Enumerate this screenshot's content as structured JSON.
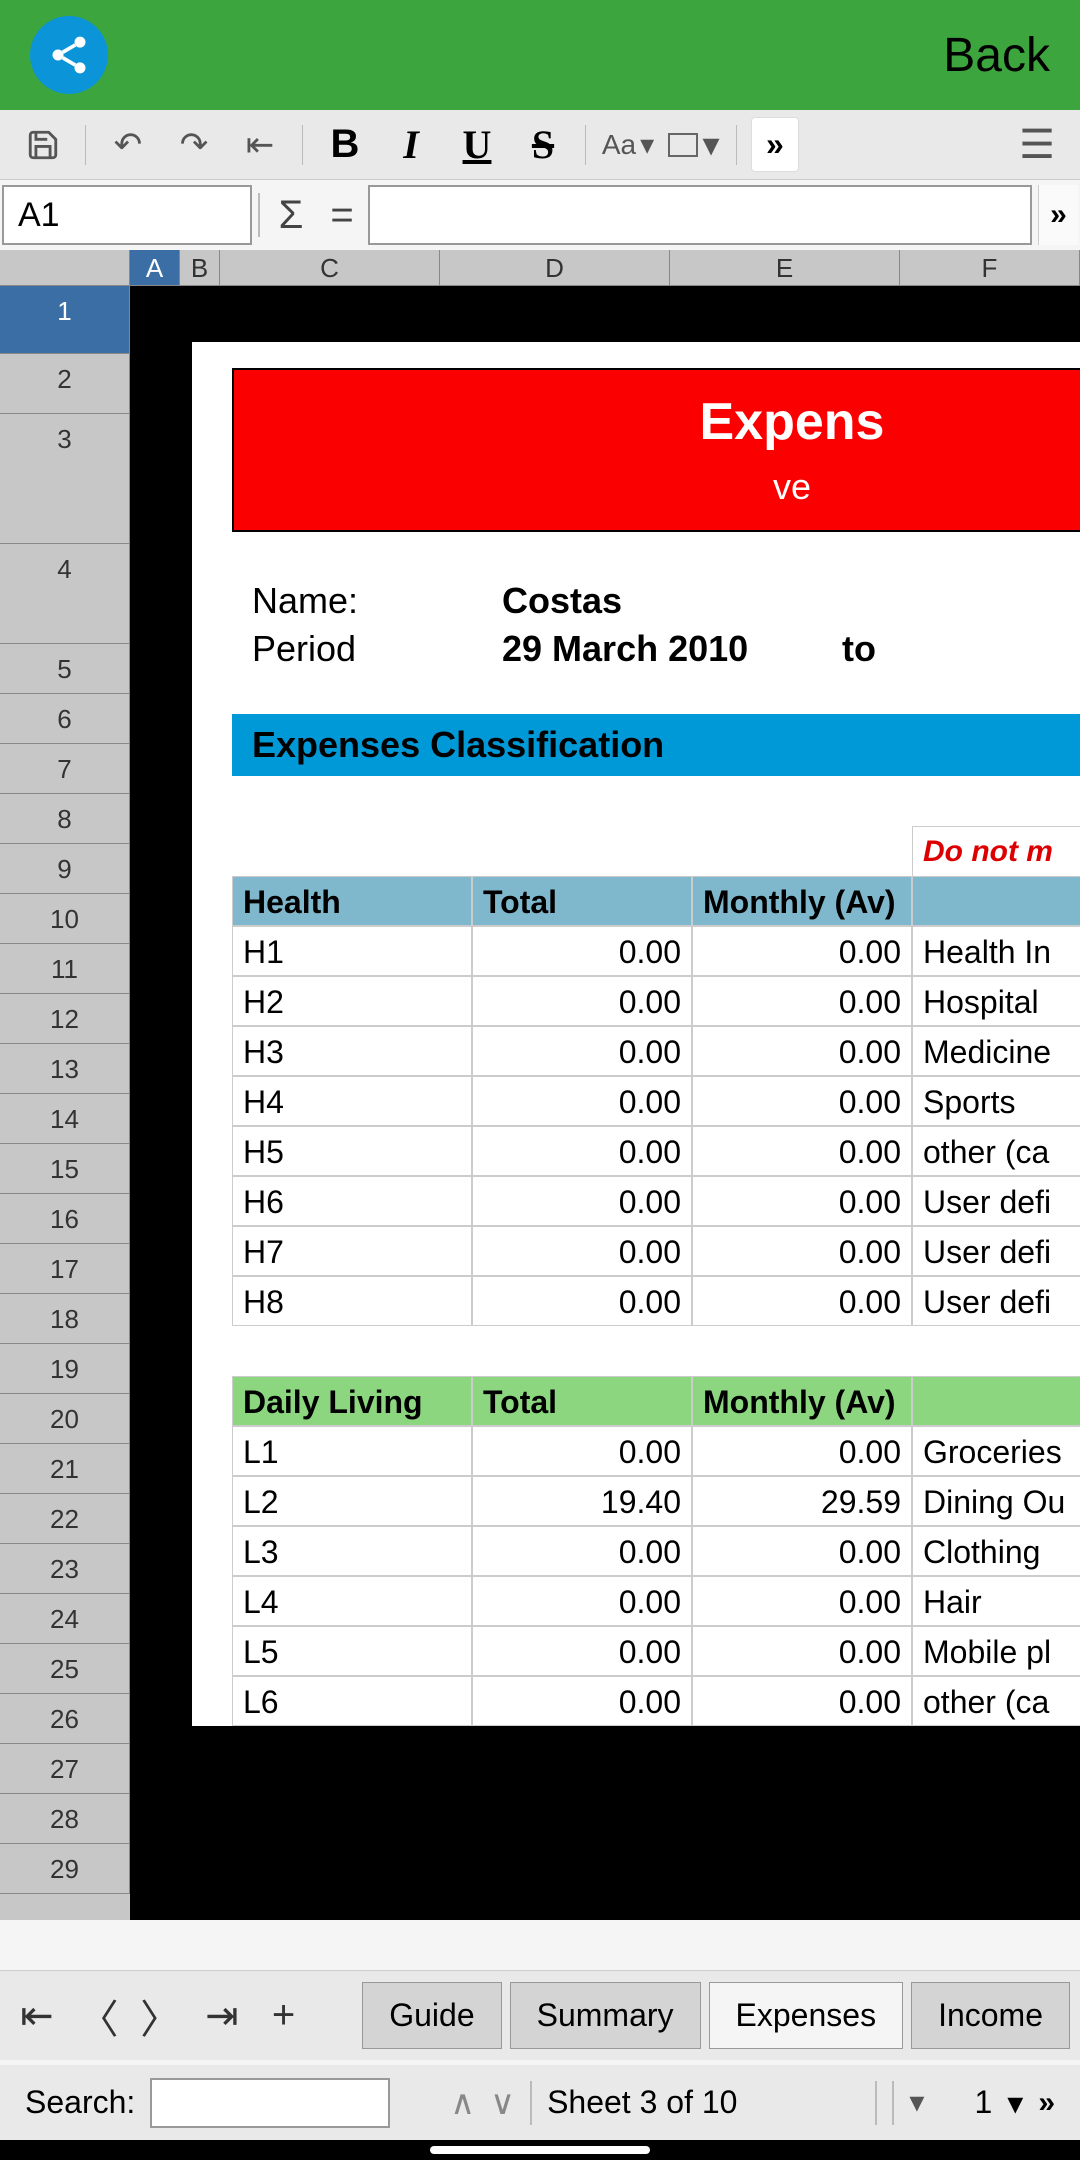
{
  "topbar": {
    "back": "Back"
  },
  "toolbar": {
    "font_label": "Aa",
    "expand": "»"
  },
  "formulabar": {
    "cellref": "A1",
    "sigma": "Σ",
    "eq": "="
  },
  "columns": [
    "A",
    "B",
    "C",
    "D",
    "E",
    "F"
  ],
  "rows": [
    "1",
    "2",
    "3",
    "4",
    "5",
    "6",
    "7",
    "8",
    "9",
    "10",
    "11",
    "12",
    "13",
    "14",
    "15",
    "16",
    "17",
    "18",
    "19",
    "20",
    "21",
    "22",
    "23",
    "24",
    "25",
    "26",
    "27",
    "28",
    "29"
  ],
  "doc": {
    "header_title": "Expens",
    "header_sub": "ve",
    "name_label": "Name:",
    "name_value": "Costas",
    "period_label": "Period",
    "period_value": "29 March 2010",
    "period_to": "to",
    "classification": "Expenses Classification",
    "warning": "Do not m",
    "col_total": "Total",
    "col_monthly": "Monthly (Av)",
    "health": {
      "title": "Health",
      "rows": [
        {
          "code": "H1",
          "total": "0.00",
          "monthly": "0.00",
          "desc": "Health In"
        },
        {
          "code": "H2",
          "total": "0.00",
          "monthly": "0.00",
          "desc": "Hospital "
        },
        {
          "code": "H3",
          "total": "0.00",
          "monthly": "0.00",
          "desc": "Medicine"
        },
        {
          "code": "H4",
          "total": "0.00",
          "monthly": "0.00",
          "desc": "Sports"
        },
        {
          "code": "H5",
          "total": "0.00",
          "monthly": "0.00",
          "desc": "other (ca"
        },
        {
          "code": "H6",
          "total": "0.00",
          "monthly": "0.00",
          "desc": "User defi"
        },
        {
          "code": "H7",
          "total": "0.00",
          "monthly": "0.00",
          "desc": "User defi"
        },
        {
          "code": "H8",
          "total": "0.00",
          "monthly": "0.00",
          "desc": "User defi"
        }
      ]
    },
    "daily": {
      "title": "Daily Living",
      "rows": [
        {
          "code": "L1",
          "total": "0.00",
          "monthly": "0.00",
          "desc": "Groceries"
        },
        {
          "code": "L2",
          "total": "19.40",
          "monthly": "29.59",
          "desc": "Dining Ou"
        },
        {
          "code": "L3",
          "total": "0.00",
          "monthly": "0.00",
          "desc": "Clothing"
        },
        {
          "code": "L4",
          "total": "0.00",
          "monthly": "0.00",
          "desc": "Hair"
        },
        {
          "code": "L5",
          "total": "0.00",
          "monthly": "0.00",
          "desc": "Mobile pl"
        },
        {
          "code": "L6",
          "total": "0.00",
          "monthly": "0.00",
          "desc": "other (ca"
        }
      ]
    }
  },
  "tabs": {
    "guide": "Guide",
    "summary": "Summary",
    "expenses": "Expenses",
    "income": "Income"
  },
  "status": {
    "search_label": "Search:",
    "sheet": "Sheet 3 of 10",
    "zoom": "1"
  }
}
